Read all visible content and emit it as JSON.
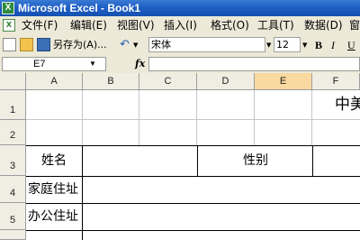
{
  "window": {
    "title": "Microsoft Excel - Book1",
    "app_icon": "excel-icon",
    "doc_icon": "workbook-icon"
  },
  "menu": {
    "items": [
      {
        "label": "文件(F)"
      },
      {
        "label": "编辑(E)"
      },
      {
        "label": "视图(V)"
      },
      {
        "label": "插入(I)"
      },
      {
        "label": "格式(O)"
      },
      {
        "label": "工具(T)"
      },
      {
        "label": "数据(D)"
      },
      {
        "label": "窗"
      }
    ]
  },
  "toolbar": {
    "save_as_label": "另存为(A)...",
    "font_name": "宋体",
    "font_size": "12",
    "bold_label": "B",
    "italic_label": "I",
    "underline_label": "U"
  },
  "formula_bar": {
    "name_box": "E7",
    "fx_label": "fx",
    "content": ""
  },
  "sheet": {
    "columns": [
      "A",
      "B",
      "C",
      "D",
      "E",
      "F"
    ],
    "selected_column": "E",
    "rows": [
      "1",
      "2",
      "3",
      "4",
      "5"
    ],
    "cells": {
      "F1": "中美",
      "A3": "姓名",
      "D3": "性别",
      "A4": "家庭住址",
      "A5": "办公住址"
    }
  }
}
